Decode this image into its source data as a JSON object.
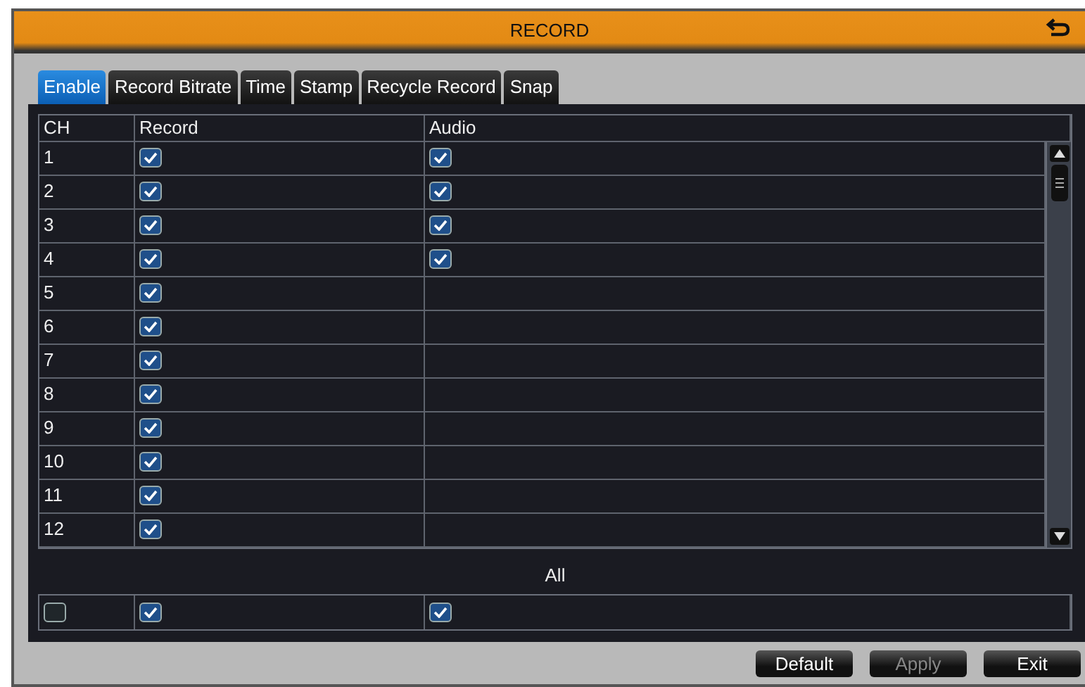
{
  "window": {
    "title": "RECORD"
  },
  "tabs": [
    {
      "label": "Enable",
      "selected": true
    },
    {
      "label": "Record Bitrate",
      "selected": false
    },
    {
      "label": "Time",
      "selected": false
    },
    {
      "label": "Stamp",
      "selected": false
    },
    {
      "label": "Recycle Record",
      "selected": false
    },
    {
      "label": "Snap",
      "selected": false
    }
  ],
  "table": {
    "columns": [
      "CH",
      "Record",
      "Audio"
    ],
    "rows": [
      {
        "ch": "1",
        "record": true,
        "audio": true
      },
      {
        "ch": "2",
        "record": true,
        "audio": true
      },
      {
        "ch": "3",
        "record": true,
        "audio": true
      },
      {
        "ch": "4",
        "record": true,
        "audio": true
      },
      {
        "ch": "5",
        "record": true
      },
      {
        "ch": "6",
        "record": true
      },
      {
        "ch": "7",
        "record": true
      },
      {
        "ch": "8",
        "record": true
      },
      {
        "ch": "9",
        "record": true
      },
      {
        "ch": "10",
        "record": true
      },
      {
        "ch": "11",
        "record": true
      },
      {
        "ch": "12",
        "record": true
      }
    ]
  },
  "all": {
    "label": "All",
    "ch": false,
    "record": true,
    "audio": true
  },
  "buttons": [
    {
      "label": "Default",
      "disabled": false
    },
    {
      "label": "Apply",
      "disabled": true
    },
    {
      "label": "Exit",
      "disabled": false
    }
  ]
}
